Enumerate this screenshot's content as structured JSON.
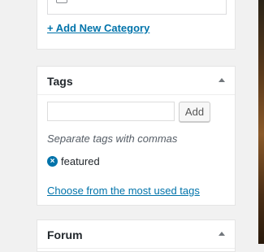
{
  "categories": {
    "cut_item_label": "Ox",
    "add_new_label": "+ Add New Category"
  },
  "tags": {
    "title": "Tags",
    "input_value": "",
    "add_button_label": "Add",
    "hint": "Separate tags with commas",
    "items": [
      {
        "label": "featured",
        "remove_icon": "x-circle"
      }
    ],
    "most_used_label": "Choose from the most used tags"
  },
  "forum": {
    "title": "Forum"
  },
  "colors": {
    "link": "#0073aa",
    "panel_bg": "#ffffff",
    "page_bg": "#f1f1f1"
  }
}
